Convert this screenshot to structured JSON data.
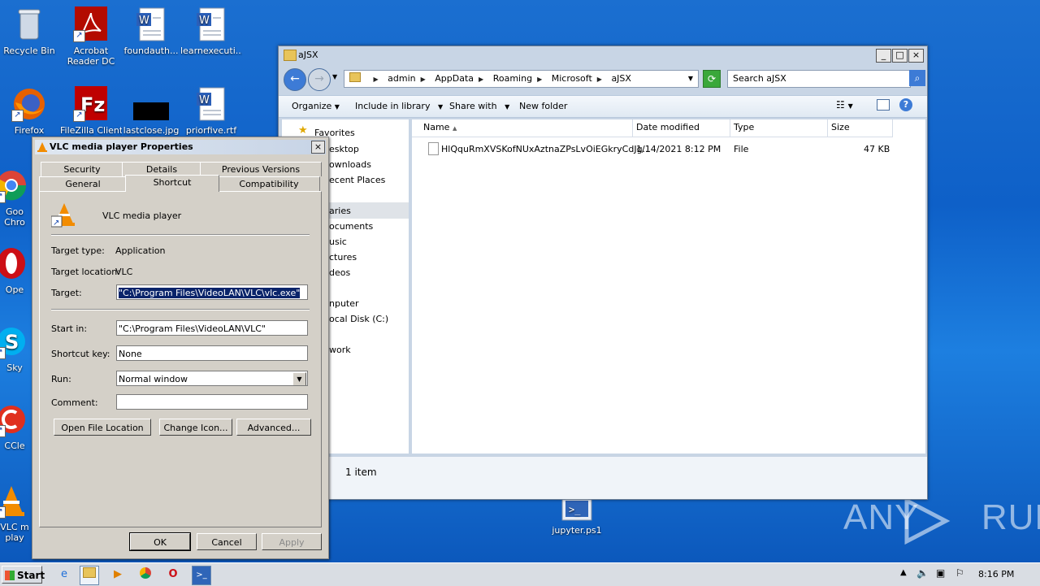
{
  "desktop": {
    "icons": [
      {
        "label": "Recycle Bin",
        "icon": "recycle-bin-icon"
      },
      {
        "label": "Acrobat Reader DC",
        "icon": "acrobat-icon"
      },
      {
        "label": "foundauth...",
        "icon": "word-doc-icon"
      },
      {
        "label": "learnexecuti...",
        "icon": "word-doc-icon"
      },
      {
        "label": "Firefox",
        "icon": "firefox-icon"
      },
      {
        "label": "FileZilla Client",
        "icon": "filezilla-icon"
      },
      {
        "label": "lastclose.jpg",
        "icon": "image-file-icon"
      },
      {
        "label": "priorfive.rtf",
        "icon": "word-doc-icon"
      },
      {
        "label": "Goo Chro",
        "icon": "chrome-icon"
      },
      {
        "label": "Ope",
        "icon": "opera-icon"
      },
      {
        "label": "Sky",
        "icon": "skype-icon"
      },
      {
        "label": "CCle",
        "icon": "ccleaner-icon"
      },
      {
        "label": "VLC m play",
        "icon": "vlc-icon"
      },
      {
        "label": "jupyter.ps1",
        "icon": "powershell-icon"
      }
    ],
    "watermark": "ANY RUN"
  },
  "explorer": {
    "title": "aJSX",
    "breadcrumbs": [
      "admin",
      "AppData",
      "Roaming",
      "Microsoft",
      "aJSX"
    ],
    "search_placeholder": "Search aJSX",
    "toolbar": {
      "organize": "Organize",
      "include": "Include in library",
      "share": "Share with",
      "new_folder": "New folder"
    },
    "nav": [
      "Favorites",
      "esktop",
      "ownloads",
      "ecent Places",
      "aries",
      "ocuments",
      "usic",
      "ctures",
      "deos",
      "nputer",
      "ocal Disk (C:)",
      "work"
    ],
    "columns": {
      "name": "Name",
      "date": "Date modified",
      "type": "Type",
      "size": "Size"
    },
    "file": {
      "name": "HlQquRmXVSKofNUxAztnaZPsLvOiEGkryCdJg...",
      "date": "1/14/2021 8:12 PM",
      "type": "File",
      "size": "47 KB"
    },
    "status": "1 item"
  },
  "dialog": {
    "title": "VLC media player Properties",
    "tabs_row1": [
      "Security",
      "Details",
      "Previous Versions"
    ],
    "tabs_row2": [
      "General",
      "Shortcut",
      "Compatibility"
    ],
    "app_name": "VLC media player",
    "target_type_label": "Target type:",
    "target_type": "Application",
    "target_location_label": "Target location:",
    "target_location": "VLC",
    "target_label": "Target:",
    "target": "\"C:\\Program Files\\VideoLAN\\VLC\\vlc.exe\"",
    "start_in_label": "Start in:",
    "start_in": "\"C:\\Program Files\\VideoLAN\\VLC\"",
    "shortcut_key_label": "Shortcut key:",
    "shortcut_key": "None",
    "run_label": "Run:",
    "run": "Normal window",
    "comment_label": "Comment:",
    "comment": "",
    "btn_open_location": "Open File Location",
    "btn_change_icon": "Change Icon...",
    "btn_advanced": "Advanced...",
    "btn_ok": "OK",
    "btn_cancel": "Cancel",
    "btn_apply": "Apply"
  },
  "taskbar": {
    "start": "Start",
    "clock": "8:16 PM"
  }
}
